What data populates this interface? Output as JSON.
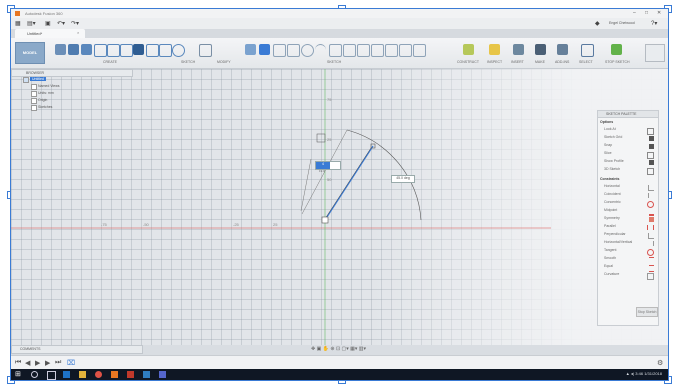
{
  "window": {
    "title": "Autodesk Fusion 360"
  },
  "document_tab": {
    "label": "Untitled*"
  },
  "user": {
    "label": "Engel Chetwood"
  },
  "workspace": {
    "label": "MODEL"
  },
  "ribbon": {
    "groups": [
      {
        "label": "CREATE"
      },
      {
        "label": "SKETCH"
      },
      {
        "label": "MODIFY"
      },
      {
        "label": "SKETCH"
      },
      {
        "label": "CONSTRUCT"
      },
      {
        "label": "INSPECT"
      },
      {
        "label": "INSERT"
      },
      {
        "label": "MAKE"
      },
      {
        "label": "ADD-INS"
      },
      {
        "label": "SELECT"
      },
      {
        "label": "STOP SKETCH"
      }
    ]
  },
  "browser": {
    "title": "BROWSER",
    "items": [
      {
        "label": "Untitled"
      },
      {
        "label": "Named Views"
      },
      {
        "label": "Units: mm"
      },
      {
        "label": "Origin"
      },
      {
        "label": "Sketches"
      }
    ]
  },
  "canvas": {
    "dimension_input": "4",
    "dimension_value": "19.0",
    "angle_value": "45.0 deg",
    "ruler_labels": [
      "-75",
      "-50",
      "-25",
      "25",
      "50",
      "75",
      "25"
    ]
  },
  "sketch_palette": {
    "title": "SKETCH PALETTE",
    "options_header": "Options",
    "options": [
      {
        "label": "Look At"
      },
      {
        "label": "Sketch Grid"
      },
      {
        "label": "Snap"
      },
      {
        "label": "Slice"
      },
      {
        "label": "Show Profile"
      },
      {
        "label": "3D Sketch"
      }
    ],
    "constraints_header": "Constraints",
    "constraints": [
      {
        "label": "Horizontal"
      },
      {
        "label": "Coincident"
      },
      {
        "label": "Concentric"
      },
      {
        "label": "Midpoint"
      },
      {
        "label": "Symmetry"
      },
      {
        "label": "Parallel"
      },
      {
        "label": "Perpendicular"
      },
      {
        "label": "Horizontal/Vertical"
      },
      {
        "label": "Tangent"
      },
      {
        "label": "Smooth"
      },
      {
        "label": "Equal"
      },
      {
        "label": "Curvature"
      }
    ],
    "stop_label": "Stop Sketch"
  },
  "comments": {
    "title": "COMMENTS"
  },
  "taskbar": {
    "time": "3:46",
    "date": "1/31/2018"
  },
  "colors": {
    "accent": "#3a7bd5",
    "axis_red": "#d9534f",
    "axis_green": "#5cb85c",
    "taskbar": "#0f1724"
  }
}
